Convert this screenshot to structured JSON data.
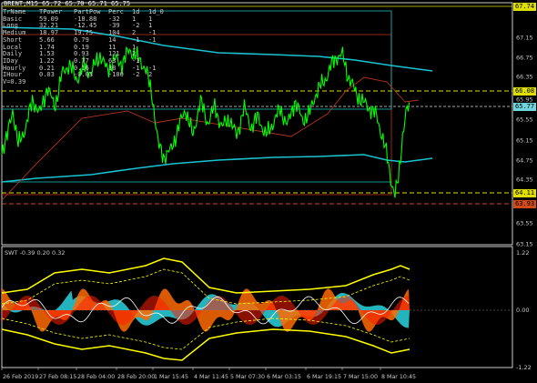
{
  "header": {
    "symbol_text": "BRENT,M15",
    "ohlc_text": "65.72 65.70 65.71 65.75"
  },
  "trend_table": {
    "columns": [
      "TrName",
      "TPower",
      "PartPow",
      "Perc",
      "1d",
      "1d_0"
    ],
    "rows": [
      [
        "Basic",
        "59.09",
        "-18.88",
        "-32",
        "1",
        "1"
      ],
      [
        "Long",
        "32.21",
        "-12.45",
        "-39",
        "-2",
        "1"
      ],
      [
        "Medium",
        "18.97",
        "19.75",
        "104",
        "2",
        "-1"
      ],
      [
        "Short",
        "5.66",
        "0.79",
        "14",
        "-1",
        "-1"
      ],
      [
        "Local",
        "1.74",
        "0.19",
        "11",
        "1",
        ""
      ],
      [
        "Daily",
        "1.53",
        "0.93",
        "121",
        "2",
        ""
      ],
      [
        "IDay",
        "1.22",
        "0.77",
        "63",
        "-1",
        ""
      ],
      [
        "Hourly",
        "0.21",
        "0.16",
        "38",
        "-1",
        "-1"
      ],
      [
        "IHour",
        "0.03",
        "-0.03",
        "-100",
        "-2",
        "2"
      ]
    ],
    "footer": "V=0.39"
  },
  "price_axis": {
    "labels": [
      "67.74",
      "67.15",
      "66.75",
      "66.35",
      "66.08",
      "65.95",
      "65.77",
      "65.55",
      "65.15",
      "64.75",
      "64.35",
      "64.11",
      "63.93",
      "63.55",
      "63.15"
    ],
    "highlight_labels": [
      {
        "text": "67.74",
        "color": "#dede00"
      },
      {
        "text": "66.08",
        "color": "#dede00"
      },
      {
        "text": "65.77",
        "color": "#6fd6dc"
      },
      {
        "text": "64.11",
        "color": "#dede00"
      },
      {
        "text": "63.93",
        "color": "#d04a1a"
      }
    ]
  },
  "indicator": {
    "label": "SWT -0.39 0.20 0.32",
    "axis_labels": [
      "1.22",
      "0.00",
      "-1.22"
    ]
  },
  "time_axis": {
    "labels": [
      "26 Feb 2019",
      "27 Feb 08:15",
      "28 Feb 04:00",
      "28 Feb 20:00",
      "1 Mar 15:45",
      "4 Mar 11:45",
      "5 Mar 07:30",
      "6 Mar 03:15",
      "6 Mar 19:15",
      "7 Mar 15:00",
      "8 Mar 10:45"
    ]
  },
  "colors": {
    "background": "#000000",
    "price_line": "#00ff00",
    "ma_slow": "#19c3d2",
    "ma_fast": "#b4321e",
    "level_yellow": "#dede00",
    "level_orange": "#d04a1a",
    "swt_orange": "#ff6a00",
    "swt_red": "#ff1e00",
    "swt_cyan": "#28c8d2",
    "swt_yellow": "#ffff00"
  }
}
